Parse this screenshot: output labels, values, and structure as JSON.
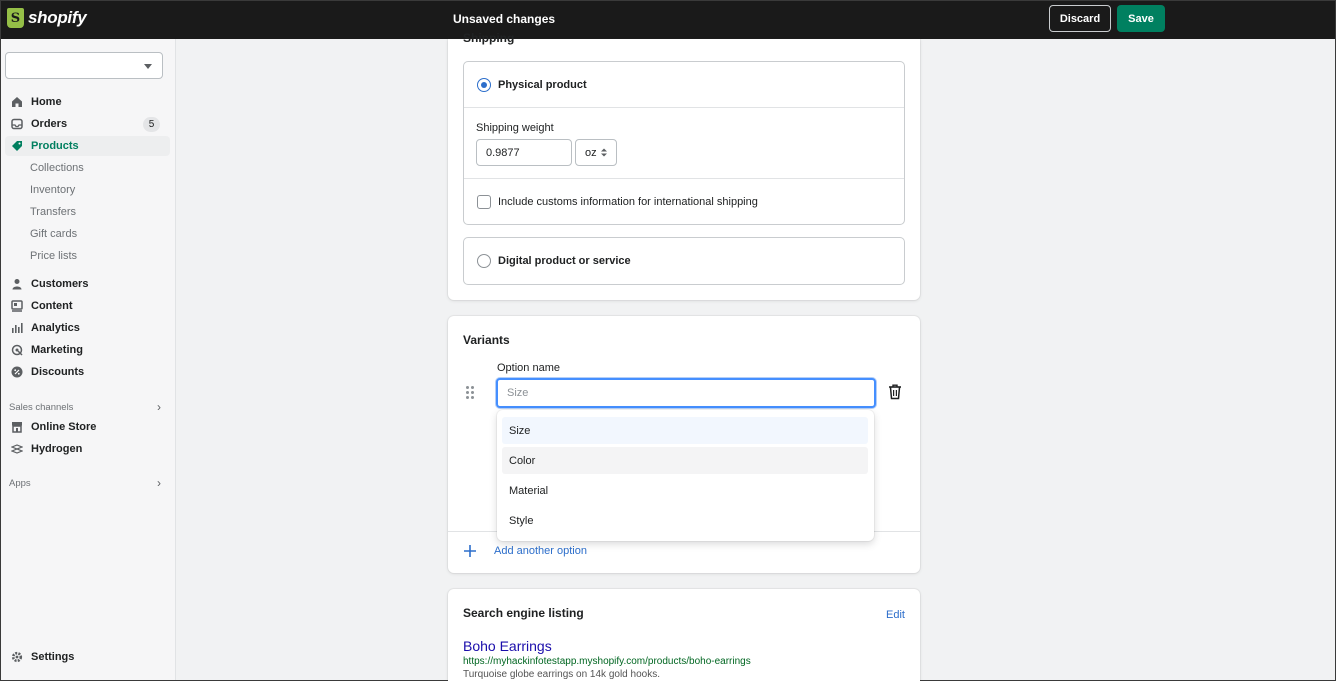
{
  "topbar": {
    "logo_text": "shopify",
    "logo_glyph": "S",
    "status": "Unsaved changes",
    "discard_label": "Discard",
    "save_label": "Save",
    "save_color": "#008060"
  },
  "sidebar": {
    "store_select_value": "",
    "items": [
      {
        "label": "Home",
        "icon": "home-icon"
      },
      {
        "label": "Orders",
        "icon": "inbox-icon",
        "badge": "5"
      },
      {
        "label": "Products",
        "icon": "tag-icon",
        "active": true
      }
    ],
    "product_subitems": [
      "Collections",
      "Inventory",
      "Transfers",
      "Gift cards",
      "Price lists"
    ],
    "items2": [
      {
        "label": "Customers",
        "icon": "person-icon"
      },
      {
        "label": "Content",
        "icon": "content-icon"
      },
      {
        "label": "Analytics",
        "icon": "bar-chart-icon"
      },
      {
        "label": "Marketing",
        "icon": "target-icon"
      },
      {
        "label": "Discounts",
        "icon": "discount-icon"
      }
    ],
    "sales_channels_label": "Sales channels",
    "channels": [
      {
        "label": "Online Store",
        "icon": "store-icon"
      },
      {
        "label": "Hydrogen",
        "icon": "hydrogen-icon"
      }
    ],
    "apps_label": "Apps",
    "settings_label": "Settings",
    "accent_color": "#007f5f"
  },
  "shipping": {
    "title": "Shipping",
    "physical_label": "Physical product",
    "weight_label": "Shipping weight",
    "weight_value": "0.9877",
    "unit_value": "oz",
    "customs_label": "Include customs information for international shipping",
    "digital_label": "Digital product or service"
  },
  "variants": {
    "title": "Variants",
    "option_name_label": "Option name",
    "option_placeholder": "Size",
    "suggestions": [
      "Size",
      "Color",
      "Material",
      "Style"
    ],
    "add_option_label": "Add another option"
  },
  "seo": {
    "title": "Search engine listing",
    "edit_label": "Edit",
    "page_title": "Boho Earrings",
    "url": "https://myhackinfotestapp.myshopify.com/products/boho-earrings",
    "description": "Turquoise globe earrings on 14k gold hooks."
  }
}
